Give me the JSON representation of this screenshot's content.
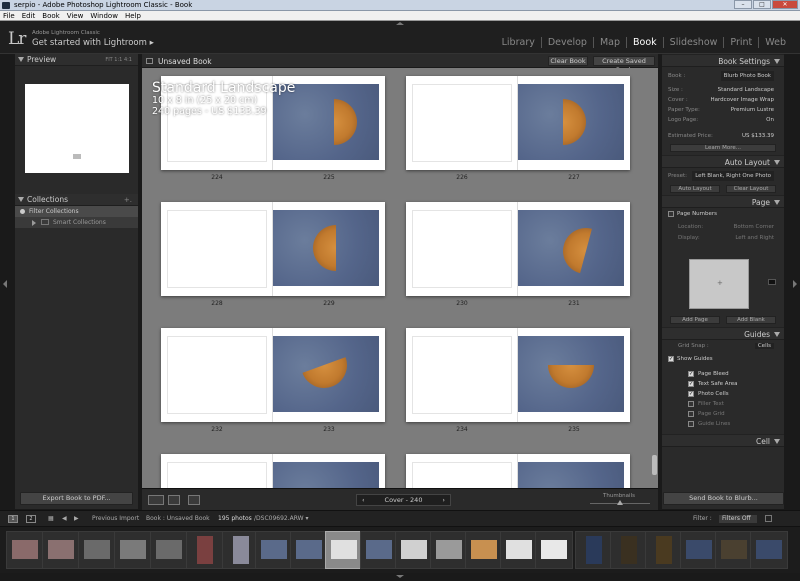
{
  "window": {
    "title": "serpio - Adobe Photoshop Lightroom Classic - Book",
    "menu": [
      "File",
      "Edit",
      "Book",
      "View",
      "Window",
      "Help"
    ],
    "controls": [
      "–",
      "□",
      "✕"
    ]
  },
  "identity": {
    "logo": "Lr",
    "line1": "Adobe Lightroom Classic",
    "line2": "Get started with Lightroom ▸"
  },
  "modules": [
    {
      "label": "Library",
      "active": false
    },
    {
      "label": "Develop",
      "active": false
    },
    {
      "label": "Map",
      "active": false
    },
    {
      "label": "Book",
      "active": true
    },
    {
      "label": "Slideshow",
      "active": false
    },
    {
      "label": "Print",
      "active": false
    },
    {
      "label": "Web",
      "active": false
    }
  ],
  "left": {
    "preview_title": "Preview",
    "preview_zoom": "FIT   1:1   4:1",
    "collections_title": "Collections",
    "collections_add": "+.",
    "filter_collections": "Filter Collections",
    "smart_collections": "Smart Collections",
    "export_label": "Export Book to PDF..."
  },
  "center": {
    "book_name": "Unsaved Book",
    "clear_book": "Clear Book",
    "create_saved": "Create Saved Book",
    "overlay_title": "Standard Landscape",
    "overlay_size": "10 x 8 in (25 x 20 cm)",
    "overlay_price": "240 pages - US $133.39",
    "page_numbers": [
      "224",
      "225",
      "226",
      "227",
      "228",
      "229",
      "230",
      "231",
      "232",
      "233",
      "234",
      "235"
    ],
    "page_nav": "Cover - 240",
    "thumbnails_label": "Thumbnails"
  },
  "right": {
    "book_settings_title": "Book Settings",
    "book_label": "Book :",
    "book_value": "Blurb Photo Book",
    "size_label": "Size :",
    "size_value": "Standard Landscape",
    "cover_label": "Cover :",
    "cover_value": "Hardcover Image Wrap",
    "paper_label": "Paper Type:",
    "paper_value": "Premium Lustre",
    "logo_label": "Logo Page:",
    "logo_value": "On",
    "price_label": "Estimated Price:",
    "price_value": "US $133.39",
    "learn_more": "Learn More...",
    "auto_layout_title": "Auto Layout",
    "preset_label": "Preset:",
    "preset_value": "Left Blank, Right One Photo",
    "auto_layout_btn": "Auto Layout",
    "clear_layout_btn": "Clear Layout",
    "page_title": "Page",
    "page_numbers_label": "Page Numbers",
    "location_label": "Location:",
    "location_value": "Bottom Corner",
    "display_label": "Display:",
    "display_value": "Left and Right",
    "add_page": "Add Page",
    "add_blank": "Add Blank",
    "guides_title": "Guides",
    "grid_snap_label": "Grid Snap :",
    "grid_snap_value": "Cells",
    "show_guides": "Show Guides",
    "page_bleed": "Page Bleed",
    "text_safe_area": "Text Safe Area",
    "photo_cells": "Photo Cells",
    "filler_text": "Filler Text",
    "page_grid": "Page Grid",
    "guide_lines": "Guide Lines",
    "cell_title": "Cell",
    "send_label": "Send Book to Blurb..."
  },
  "filmbar": {
    "view1": "1",
    "view2": "2",
    "previous_import": "Previous Import",
    "breadcrumb": "Book : Unsaved Book",
    "count": "195 photos",
    "file": "/DSC09692.ARW ▾",
    "filter_label": "Filter :",
    "filter_value": "Filters Off"
  }
}
